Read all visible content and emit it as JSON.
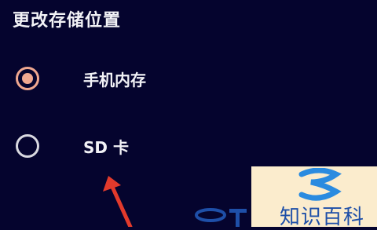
{
  "dialog": {
    "title": "更改存储位置",
    "options": [
      {
        "label": "手机内存",
        "selected": true
      },
      {
        "label": "SD 卡",
        "selected": false
      }
    ]
  },
  "watermark": {
    "text": "知识百科"
  },
  "colors": {
    "background": "#05042e",
    "radio_selected": "#f0a890",
    "arrow": "#e23a2c",
    "watermark_blue": "#1e4fa8",
    "watermark_panel": "#fbeccd"
  }
}
